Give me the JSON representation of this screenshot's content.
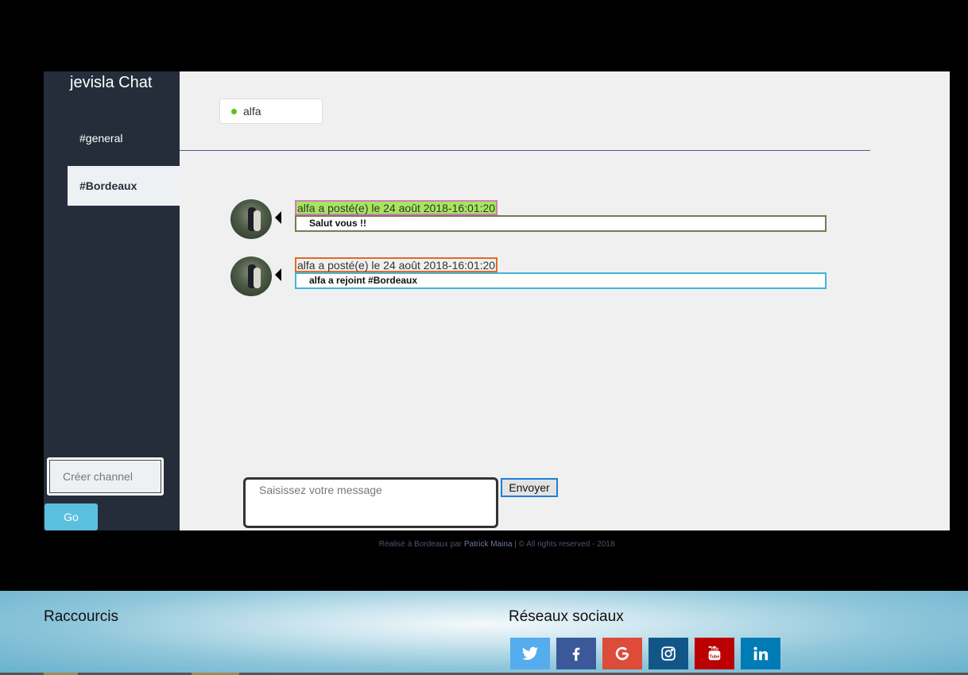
{
  "app": {
    "title": "jevisla Chat"
  },
  "sidebar": {
    "channels": [
      {
        "label": "#general",
        "active": false
      },
      {
        "label": "#Bordeaux",
        "active": true
      }
    ],
    "create_channel_placeholder": "Créer channel",
    "go_label": "Go"
  },
  "main": {
    "online_users": [
      {
        "name": "alfa",
        "status": "online",
        "status_color": "#5cc21c"
      }
    ],
    "messages": [
      {
        "header": "alfa a posté(e) le 24 août 2018-16:01:20",
        "text": "Salut vous !!"
      },
      {
        "header": "alfa a posté(e) le 24 août 2018-16:01:20",
        "text": "alfa a rejoint #Bordeaux"
      }
    ],
    "composer": {
      "placeholder": "Saisissez votre message",
      "send_label": "Envoyer"
    }
  },
  "credits": {
    "prefix": "Réalisé à Bordeaux par ",
    "author": "Patrick Maina",
    "suffix": " | © All rights reserved - 2018"
  },
  "footer": {
    "shortcuts_title": "Raccourcis",
    "social_title": "Réseaux sociaux",
    "social_links": [
      {
        "icon": "twitter-icon",
        "color": "#55acee"
      },
      {
        "icon": "facebook-icon",
        "color": "#3b5998"
      },
      {
        "icon": "google-plus-icon",
        "color": "#dd4b39"
      },
      {
        "icon": "instagram-icon",
        "color": "#125688"
      },
      {
        "icon": "youtube-icon",
        "color": "#bb0000"
      },
      {
        "icon": "linkedin-icon",
        "color": "#007bb5"
      }
    ]
  }
}
